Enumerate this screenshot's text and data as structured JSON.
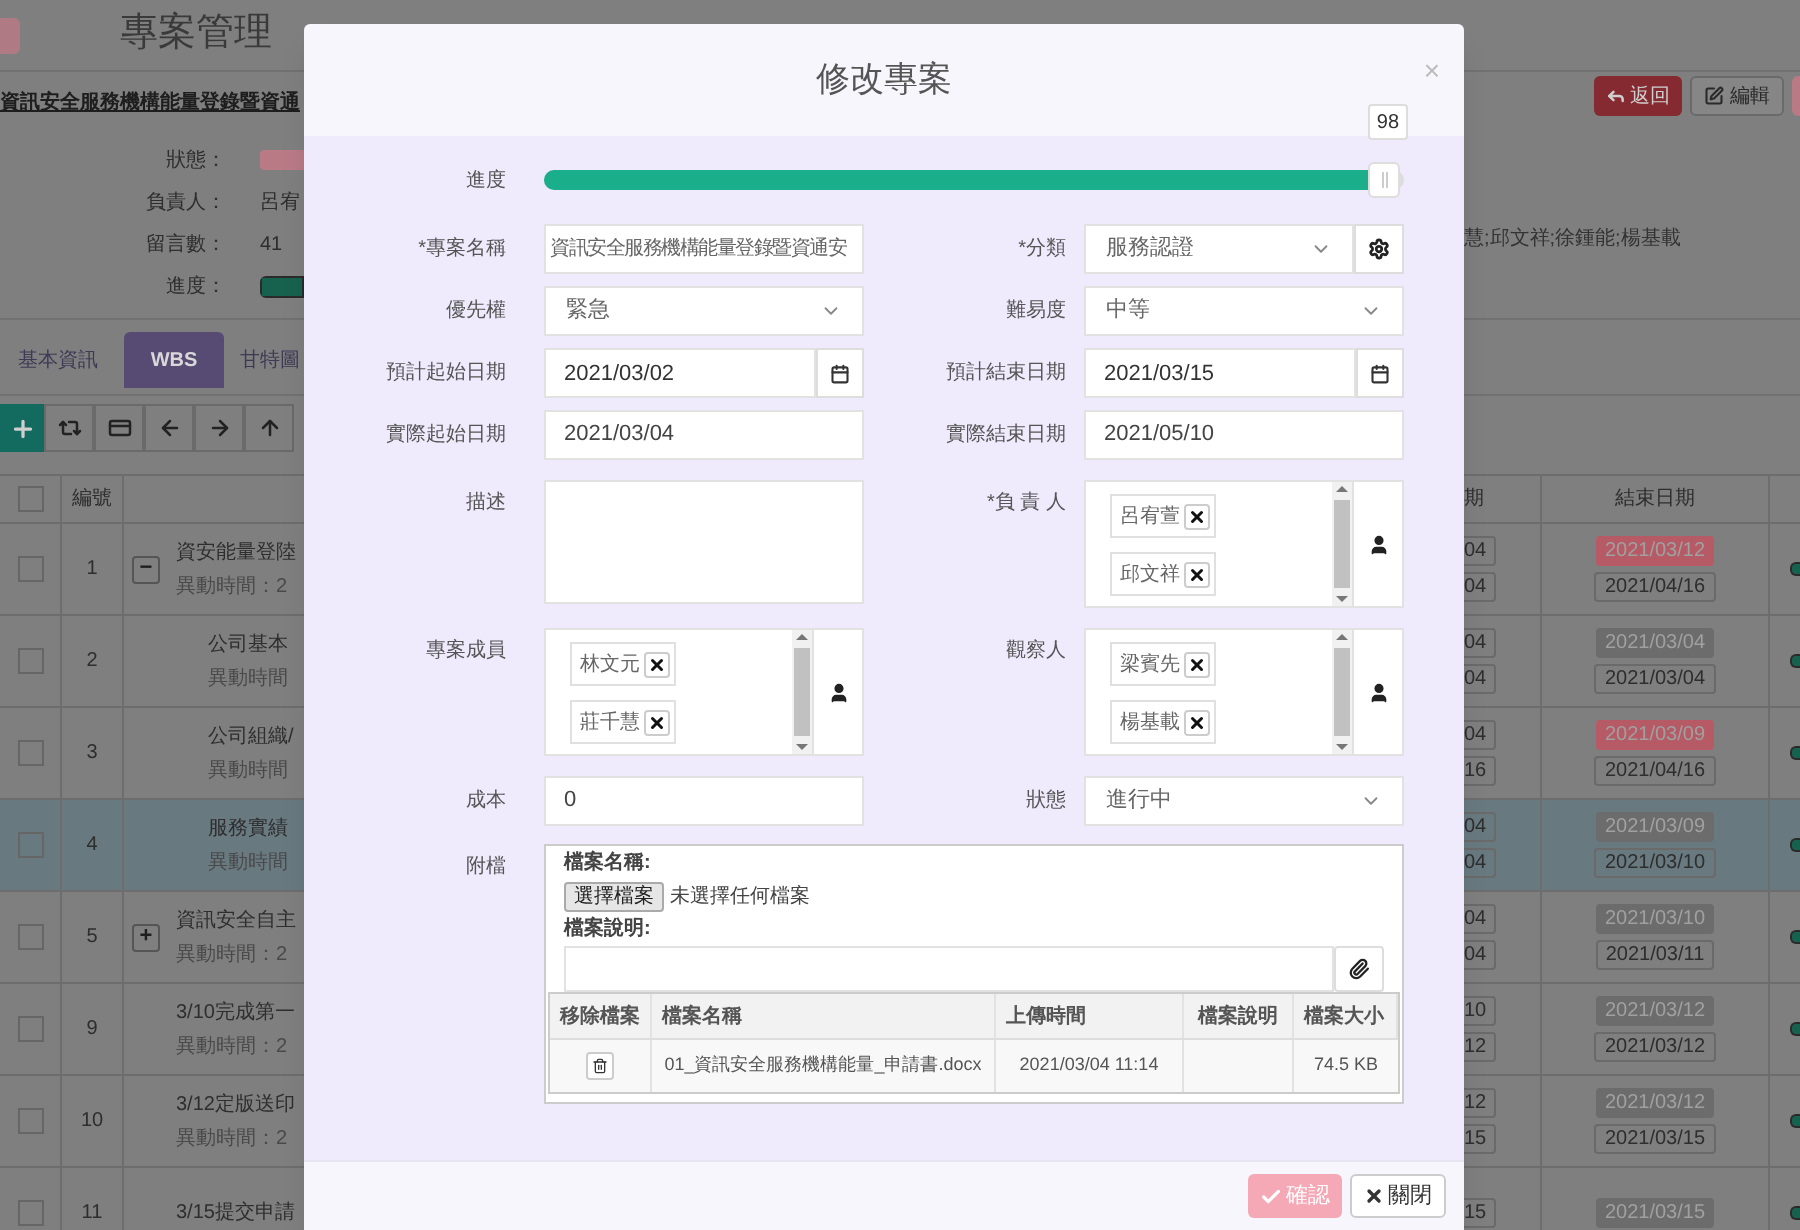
{
  "page": {
    "title": "專案管理"
  },
  "project": {
    "title": "資訊安全服務機構能量登錄暨資通",
    "info": [
      {
        "label": "狀態：",
        "kind": "badge"
      },
      {
        "label": "負責人：",
        "kind": "text",
        "value": "呂宥"
      },
      {
        "label": "留言數：",
        "kind": "text",
        "value": "41"
      },
      {
        "label": "進度：",
        "kind": "bar",
        "level": 1
      }
    ],
    "people": "慧;邱文祥;徐鍾能;楊基載",
    "actions": [
      {
        "label": "返回",
        "kind": "back"
      },
      {
        "label": "編輯",
        "kind": "edit"
      },
      {
        "kind": "cut"
      }
    ]
  },
  "tabs": [
    {
      "label": "基本資訊",
      "selected": false
    },
    {
      "label": "WBS",
      "selected": true
    },
    {
      "label": "甘特圖",
      "selected": false
    }
  ],
  "table": {
    "header_checked": false,
    "number_header": "編號",
    "start_header": "期",
    "end_header": "結束日期",
    "rows": [
      {
        "number": "1",
        "toggle": "−",
        "title": "資安能量登陸",
        "changed": "異動時間：2",
        "start": [
          "04",
          "04"
        ],
        "end_badge": {
          "text": "2021/03/12",
          "color": "#b65a66"
        },
        "end": "2021/04/16",
        "checked": false,
        "selected": false,
        "children": [
          {
            "number": "2",
            "title": "公司基本",
            "changed": "異動時間",
            "start": [
              "04",
              "04"
            ],
            "end_badge": {
              "text": "2021/03/04",
              "color": "#6c6c6c"
            },
            "end": "2021/03/04",
            "checked": false,
            "selected": false
          },
          {
            "number": "3",
            "title": "公司組織/",
            "changed": "異動時間",
            "start": [
              "04",
              "16"
            ],
            "end_badge": {
              "text": "2021/03/09",
              "color": "#b65a66"
            },
            "end": "2021/04/16",
            "checked": false,
            "selected": false
          },
          {
            "number": "4",
            "title": "服務實績",
            "changed": "異動時間",
            "start": [
              "04",
              "04"
            ],
            "end_badge": {
              "text": "2021/03/09",
              "color": "#6c6c6c"
            },
            "end": "2021/03/10",
            "checked": false,
            "selected": true
          }
        ]
      },
      {
        "number": "5",
        "toggle": "+",
        "title": "資訊安全自主",
        "changed": "異動時間：2",
        "start": [
          "04",
          "04"
        ],
        "end_badge": {
          "text": "2021/03/10",
          "color": "#6c6c6c"
        },
        "end": "2021/03/11",
        "checked": false,
        "selected": false
      },
      {
        "number": "9",
        "title": "3/10完成第一",
        "changed": "異動時間：2",
        "start": [
          "10",
          "12"
        ],
        "end_badge": {
          "text": "2021/03/12",
          "color": "#6c6c6c"
        },
        "end": "2021/03/12",
        "checked": false,
        "selected": false
      },
      {
        "number": "10",
        "title": "3/12定版送印",
        "changed": "異動時間：2",
        "start": [
          "12",
          "15"
        ],
        "end_badge": {
          "text": "2021/03/12",
          "color": "#6c6c6c"
        },
        "end": "2021/03/15",
        "checked": false,
        "selected": false
      },
      {
        "number": "11",
        "title": "3/15提交申請",
        "start": [
          "15"
        ],
        "end_badge": {
          "text": "2021/03/15",
          "color": "#6c6c6c"
        },
        "checked": false,
        "selected": false
      }
    ]
  },
  "dialog": {
    "title": "修改專案",
    "close": "×",
    "progress": {
      "label": "進度",
      "level": 0.98,
      "reading": "98"
    },
    "fields": [
      {
        "label": "*專案名稱",
        "kind": "text",
        "value": "資訊安全服務機構能量登錄暨資通安"
      },
      {
        "label": "*分類",
        "kind": "select-gear",
        "value": "服務認證"
      },
      {
        "label": "優先權",
        "kind": "select",
        "value": "緊急"
      },
      {
        "label": "難易度",
        "kind": "select",
        "value": "中等"
      },
      {
        "label": "預計起始日期",
        "kind": "date",
        "value": "2021/03/02"
      },
      {
        "label": "預計結束日期",
        "kind": "date",
        "value": "2021/03/15"
      },
      {
        "label": "實際起始日期",
        "kind": "text",
        "value": "2021/03/04"
      },
      {
        "label": "實際結束日期",
        "kind": "text",
        "value": "2021/05/10"
      },
      {
        "label": "描述",
        "kind": "textarea"
      },
      {
        "label": "*負 責 人",
        "kind": "tags",
        "tags": [
          "呂宥萱",
          "邱文祥"
        ]
      },
      {
        "label": "專案成員",
        "kind": "tags",
        "tags": [
          "林文元",
          "莊千慧"
        ]
      },
      {
        "label": "觀察人",
        "kind": "tags",
        "tags": [
          "梁賓先",
          "楊基載"
        ]
      },
      {
        "label": "成本",
        "kind": "text",
        "value": "0"
      },
      {
        "label": "狀態",
        "kind": "select",
        "value": "進行中"
      }
    ],
    "attachment": {
      "label": "附檔",
      "file_name_label": "檔案名稱:",
      "choose_button": "選擇檔案",
      "no_file": "未選擇任何檔案",
      "desc_label": "檔案說明:",
      "columns": [
        "移除檔案",
        "檔案名稱",
        "上傳時間",
        "檔案說明",
        "檔案大小"
      ],
      "files": [
        {
          "name": "01_資訊安全服務機構能量_申請書.docx",
          "time": "2021/03/04 11:14",
          "size": "74.5 KB"
        }
      ]
    },
    "buttons": [
      {
        "label": "確認",
        "kind": "confirm",
        "disabled": true
      },
      {
        "label": "關閉",
        "kind": "close",
        "disabled": false
      }
    ]
  }
}
